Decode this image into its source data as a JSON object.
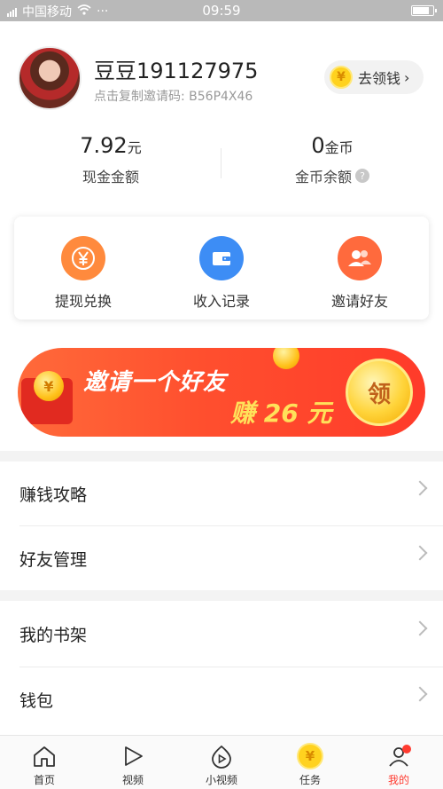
{
  "status_bar": {
    "carrier": "中国移动",
    "dots": "···",
    "time": "09:59"
  },
  "profile": {
    "name": "豆豆191127975",
    "invite_text": "点击复制邀请码: B56P4X46",
    "get_money_button": "去领钱",
    "get_money_icon": "coin-yen-icon"
  },
  "stats": {
    "cash": {
      "value": "7.92",
      "unit": "元",
      "label": "现金金额"
    },
    "coins": {
      "value": "0",
      "unit": "金币",
      "label": "金币余额"
    }
  },
  "actions": [
    {
      "label": "提现兑换",
      "icon": "yen-icon",
      "color": "#ff8a3d"
    },
    {
      "label": "收入记录",
      "icon": "wallet-icon",
      "color": "#3d8df5"
    },
    {
      "label": "邀请好友",
      "icon": "friends-icon",
      "color": "#ff6a3d"
    }
  ],
  "banner": {
    "line1": "邀请一个好友",
    "line2": "赚 26 元",
    "claim": "领",
    "colors": {
      "start": "#ff6a3a",
      "end": "#ff3b2a",
      "accent": "#ffe15a"
    }
  },
  "menu": [
    {
      "label": "赚钱攻略"
    },
    {
      "label": "好友管理"
    },
    {
      "label": "我的书架"
    },
    {
      "label": "钱包"
    }
  ],
  "tabbar": [
    {
      "label": "首页",
      "icon": "home-icon"
    },
    {
      "label": "视频",
      "icon": "play-icon"
    },
    {
      "label": "小视频",
      "icon": "short-video-icon"
    },
    {
      "label": "任务",
      "icon": "task-coin-icon"
    },
    {
      "label": "我的",
      "icon": "profile-icon",
      "active": true
    }
  ]
}
